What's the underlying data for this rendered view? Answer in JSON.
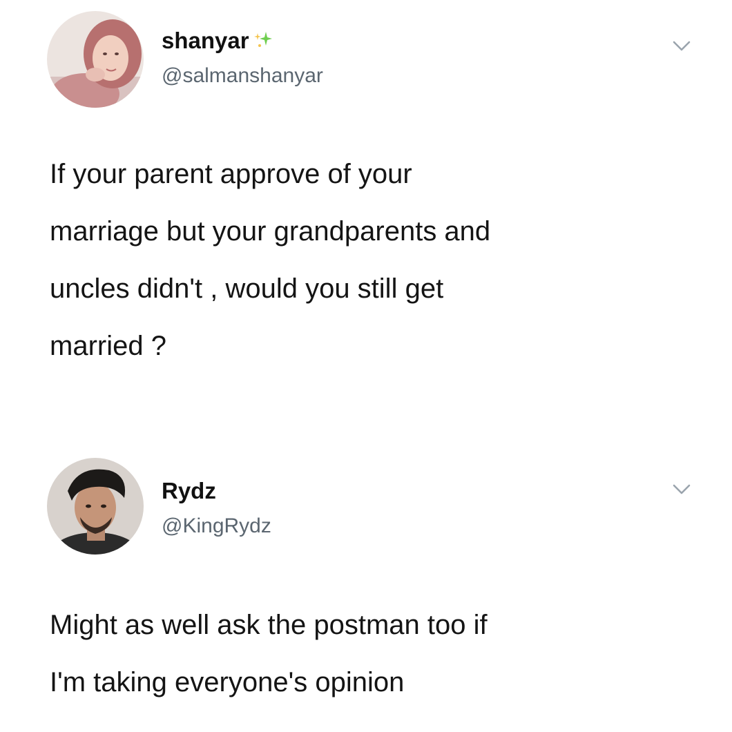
{
  "tweets": [
    {
      "display_name": "shanyar",
      "handle": "@salmanshanyar",
      "text": "If your parent approve of your\nmarriage but your grandparents and\nuncles didn't , would you still get\nmarried ?",
      "avatar_icon": "profile-photo-avatar",
      "badge_icon": "sparkle-icon",
      "menu_icon": "chevron-down-icon"
    },
    {
      "display_name": "Rydz",
      "handle": "@KingRydz",
      "text": "Might as well ask the postman too if\nI'm taking everyone's opinion",
      "avatar_icon": "profile-photo-avatar",
      "menu_icon": "chevron-down-icon"
    }
  ],
  "colors": {
    "background": "#ffffff",
    "text": "#141414",
    "handle": "#5b6670",
    "chevron": "#9aa4ad",
    "sparkle_gold": "#f4c44e",
    "sparkle_green": "#6fce4f"
  }
}
